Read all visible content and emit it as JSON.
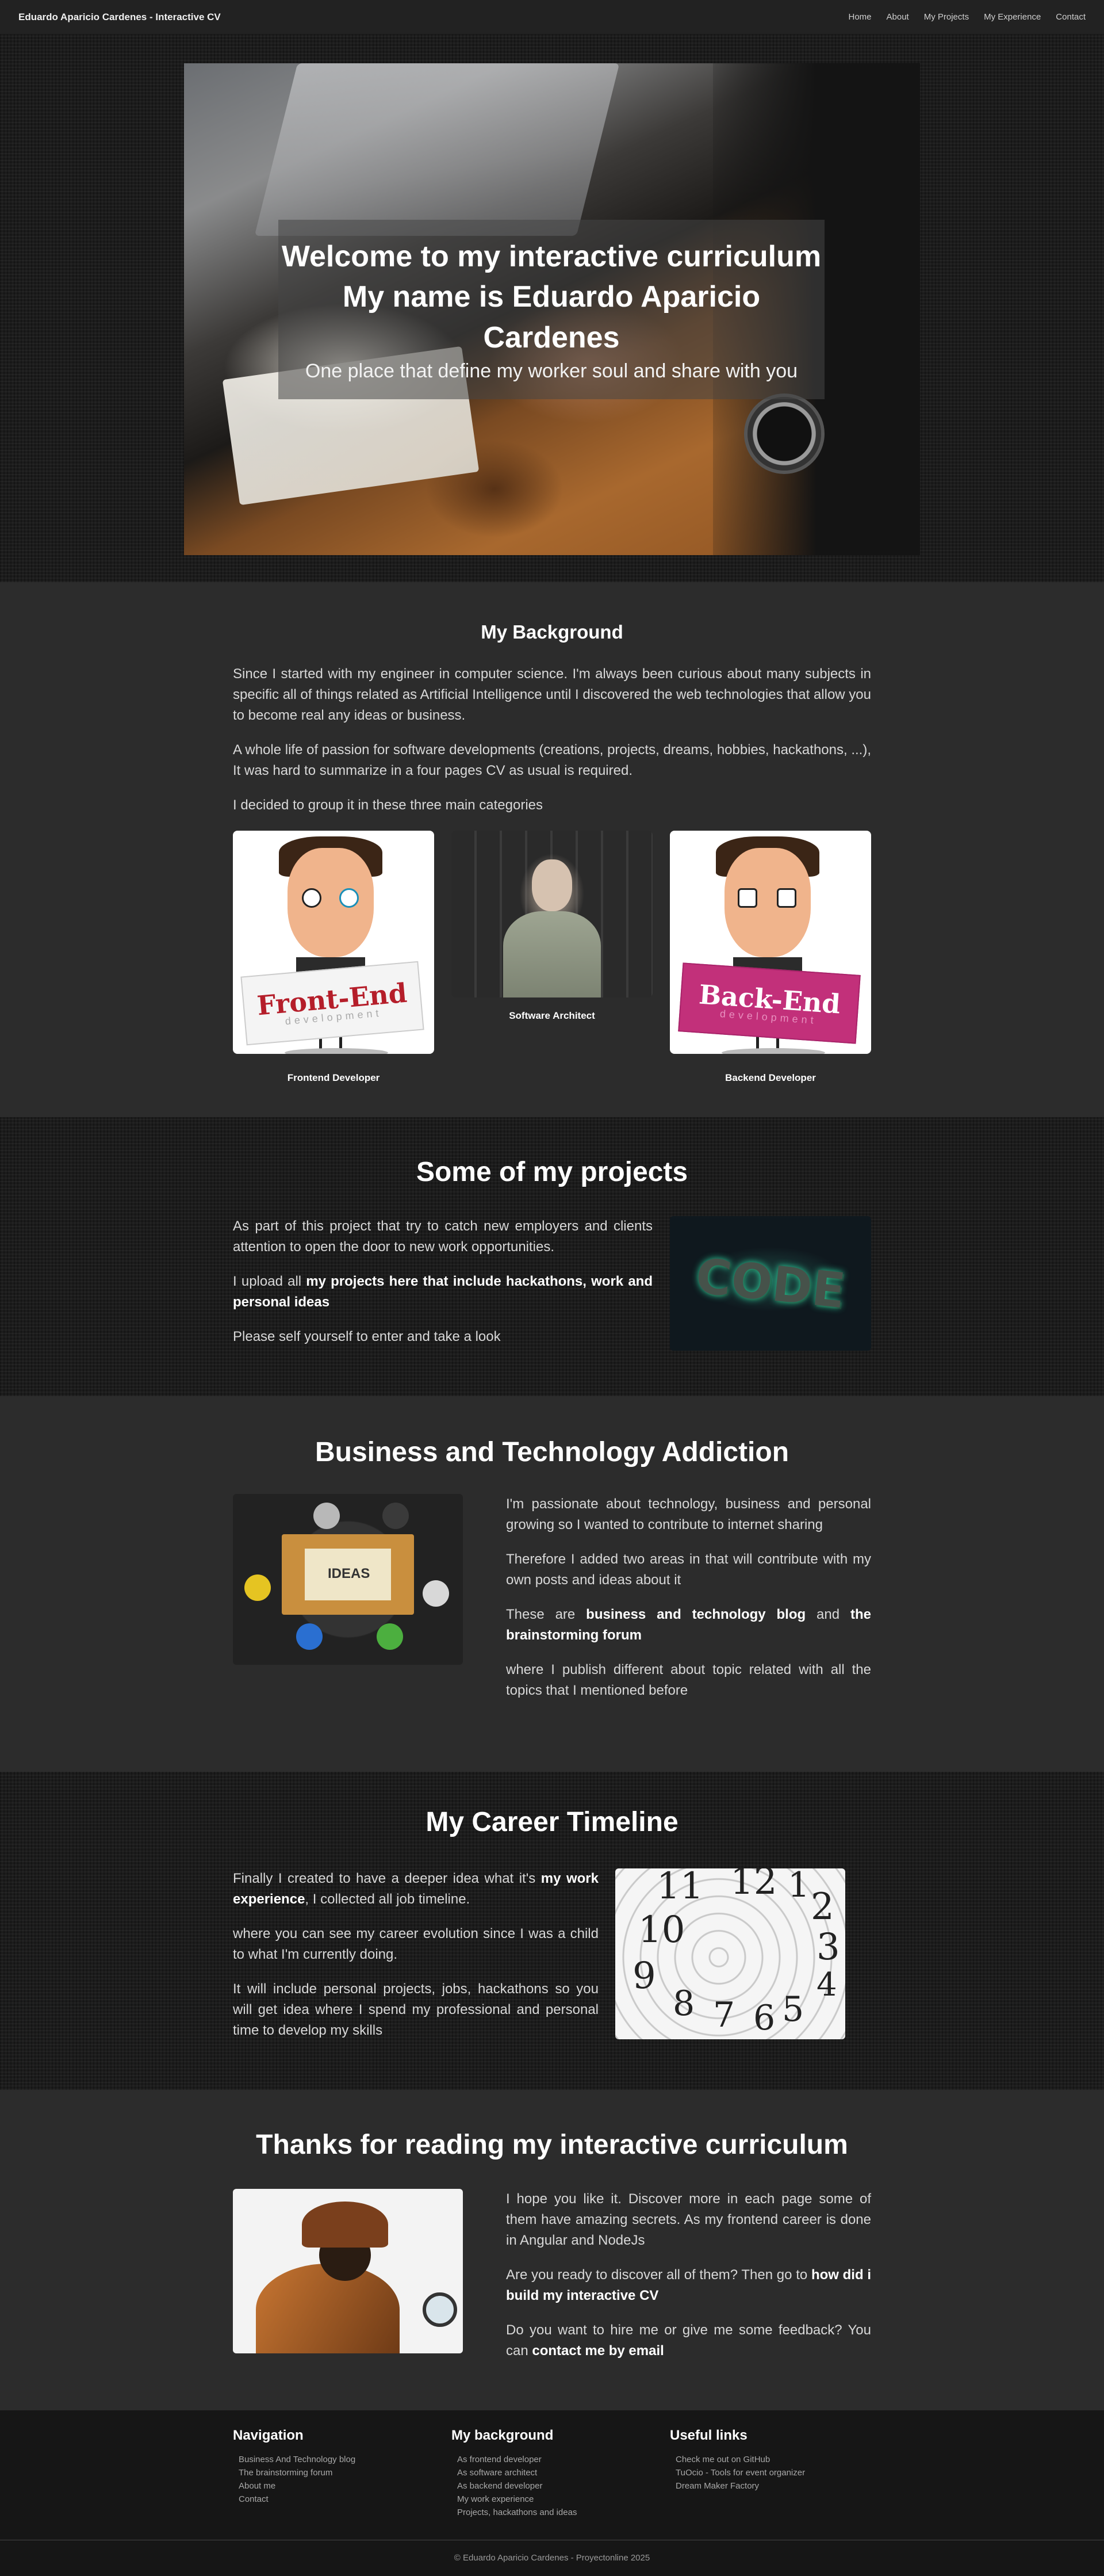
{
  "navbar": {
    "brand": "Eduardo Aparicio Cardenes - Interactive CV",
    "links": [
      "Home",
      "About",
      "My Projects",
      "My Experience",
      "Contact"
    ]
  },
  "hero": {
    "title_line1": "Welcome to my interactive curriculum",
    "title_line2": "My name is Eduardo Aparicio Cardenes",
    "subtitle": "One place that define my worker soul and share with you"
  },
  "background": {
    "title": "My Background",
    "paragraphs": [
      "Since I started with my engineer in computer science. I'm always been curious about many subjects in specific all of things related as Artificial Intelligence until I discovered the web technologies that allow you to become real any ideas or business.",
      "A whole life of passion for software developments (creations, projects, dreams, hobbies, hackathons, ...), It was hard to summarize in a four pages CV as usual is required.",
      "I decided to group it in these three main categories"
    ],
    "cards": [
      {
        "label": "Frontend Developer",
        "sign": "Front-End",
        "sign_sub": "development"
      },
      {
        "label": "Software Architect"
      },
      {
        "label": "Backend Developer",
        "sign": "Back-End",
        "sign_sub": "development"
      }
    ]
  },
  "projects": {
    "title": "Some of my projects",
    "p1": "As part of this project that try to catch new employers and clients attention to open the door to new work opportunities.",
    "p2_prefix": "I upload all ",
    "p2_link": "my projects here that include hackathons, work and personal ideas",
    "p3": "Please self yourself to enter and take a look",
    "image_word": "CODE"
  },
  "business": {
    "title": "Business and Technology Addiction",
    "p1": "I'm passionate about technology, business and personal growing so I wanted to contribute to internet sharing",
    "p2": "Therefore I added two areas in that will contribute with my own posts and ideas about it",
    "p3_prefix": "These are ",
    "p3_link1": "business and technology blog",
    "p3_mid": " and ",
    "p3_link2": "the brainstorming forum",
    "p4": "where I publish different about topic related with all the topics that I mentioned before",
    "image_text": "IDEAS"
  },
  "career": {
    "title": "My Career Timeline",
    "p1_prefix": "Finally I created to have a deeper idea what it's ",
    "p1_link": "my work experience",
    "p1_suffix": ", I collected all job timeline.",
    "p2": "where you can see my career evolution since I was a child to what I'm currently doing.",
    "p3": "It will include personal projects, jobs, hackathons so you will get idea where I spend my professional and personal time to develop my skills",
    "clock_numbers": [
      "11",
      "12",
      "1",
      "2",
      "3",
      "10",
      "9",
      "8",
      "7",
      "6",
      "5",
      "4"
    ]
  },
  "thanks": {
    "title": "Thanks for reading my interactive curriculum",
    "p1": "I hope you like it. Discover more in each page some of them have amazing secrets. As my frontend career is done in Angular and NodeJs",
    "p2_prefix": "Are you ready to discover all of them? Then go to ",
    "p2_link": "how did i build my interactive CV",
    "p3_prefix": "Do you want to hire me or give me some feedback? You can ",
    "p3_link": "contact me by email"
  },
  "footer": {
    "columns": [
      {
        "title": "Navigation",
        "items": [
          "Business And Technology blog",
          "The brainstorming forum",
          "About me",
          "Contact"
        ]
      },
      {
        "title": "My background",
        "items": [
          "As frontend developer",
          "As software architect",
          "As backend developer",
          "My work experience",
          "Projects, hackathons and ideas"
        ]
      },
      {
        "title": "Useful links",
        "items": [
          "Check me out on GitHub",
          "TuOcio - Tools for event organizer",
          "Dream Maker Factory"
        ]
      }
    ],
    "copyright": "© Eduardo Aparicio Cardenes - Proyectonline 2025"
  },
  "colors": {
    "background_dark": "#1c1c1c",
    "section_flat": "#2c2c2c",
    "footer": "#161616",
    "front_end_sign": "#b51e2a",
    "back_end_sign": "#c2307a"
  }
}
